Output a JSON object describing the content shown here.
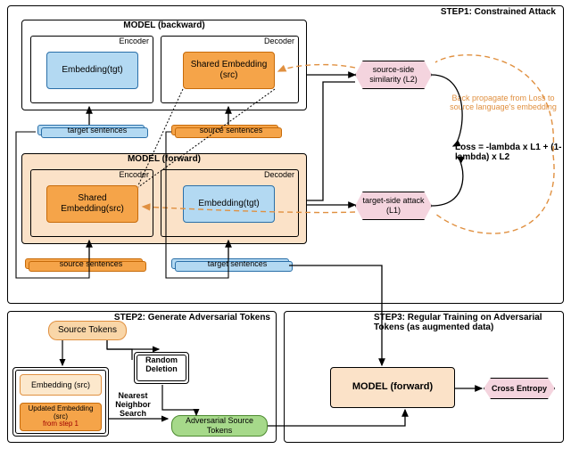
{
  "step1": {
    "title": "STEP1: Constrained Attack",
    "backward": {
      "label": "MODEL (backward)",
      "encoder": "Encoder",
      "decoder": "Decoder",
      "enc_block": "Embedding(tgt)",
      "dec_block": "Shared Embedding (src)"
    },
    "forward": {
      "label": "MODEL (forward)",
      "encoder": "Encoder",
      "decoder": "Decoder",
      "enc_block": "Shared Embedding(src)",
      "dec_block": "Embedding(tgt)"
    },
    "target_sentences": "target sentences",
    "source_sentences": "source sentences",
    "source_side_sim": "source-side similarity (L2)",
    "target_side_attack": "target-side attack (L1)",
    "loss": "Loss = -lambda x L1 + (1-lambda) x L2",
    "backprop_note": "Back propagate from Loss to source language's embedding"
  },
  "step2": {
    "title": "STEP2: Generate Adversarial Tokens",
    "source_tokens": "Source Tokens",
    "embedding_src": "Embedding (src)",
    "updated_embedding": "Updated Embedding (src)",
    "from_step1": "from step 1",
    "random_deletion": "Random Deletion",
    "nn_search": "Nearest Neighbor Search",
    "adv_tokens": "Adversarial Source Tokens"
  },
  "step3": {
    "title": "STEP3: Regular Training on Adversarial Tokens (as augmented data)",
    "model_forward": "MODEL (forward)",
    "cross_entropy": "Cross Entropy"
  }
}
